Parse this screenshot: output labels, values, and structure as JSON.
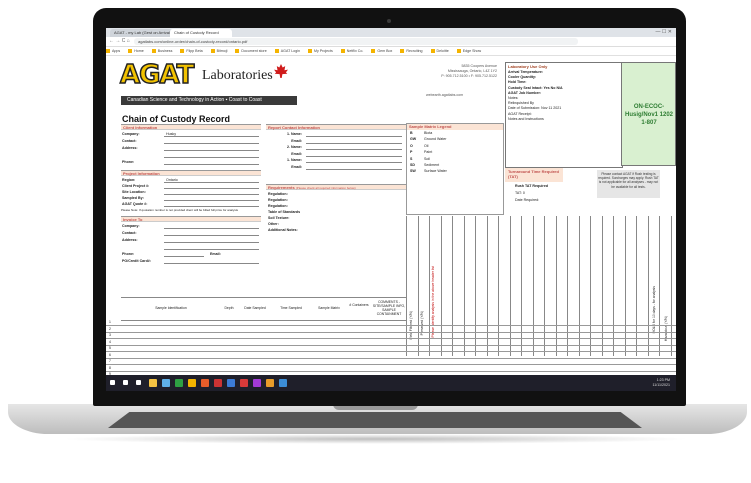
{
  "browser": {
    "tabs": [
      "AGAT - my Lab (Gest on Arrival)",
      "Chain of Custody Record"
    ],
    "nav": "← → C ⌂",
    "url": "agatlabs.com/online-order/chain-of-custody-record/ontario.pdf",
    "bookmarks": [
      "Apps",
      "Home",
      "Business",
      "Flipp Beta",
      "Bitmoji",
      "Document store",
      "AGAT Login",
      "My Projects",
      "Netflix Co.",
      "Gem Box",
      "Recruiting",
      "Deloitte",
      "Edge Show"
    ],
    "window_controls": "— ☐ ✕"
  },
  "logo": {
    "mark": "AGAT",
    "name": "Laboratories",
    "tagline": "Canadian Science and Technology in Action ▪ Coast to Coast"
  },
  "address": [
    "5835 Coopers Avenue",
    "Mississauga, Ontario, L4Z 1Y2",
    "P: 905.712.5100 • F: 905.712.5122"
  ],
  "website": "webearth.agatlabs.com",
  "lab_use": {
    "header": "Laboratory Use Only",
    "rows": [
      "Arrival Temperature:",
      "Cooler Quantity:",
      "Hold Time:",
      "Custody Seal Intact:    Yes    No    N/A",
      "AGAT Job Number:",
      "",
      "Notes:",
      "",
      "Relinquished By",
      "Date of Submission:   Nov   11   2021",
      "AGAT Receipt:",
      "Notes and Instructions"
    ]
  },
  "ref_code": [
    "ON-ECOC-",
    "Husig/Nov1 1202",
    "1-807"
  ],
  "title": "Chain of Custody Record",
  "client": {
    "header": "Client Information",
    "fields": [
      [
        "Company:",
        "Husky"
      ],
      [
        "Contact:",
        ""
      ],
      [
        "Address:",
        ""
      ],
      [
        "",
        ""
      ],
      [
        "Phone:",
        ""
      ]
    ]
  },
  "report": {
    "header": "Report Contact Information",
    "fields": [
      "1. Name:",
      "Email:",
      "2. Name:",
      "Email:",
      "1. Name:",
      "Email:"
    ]
  },
  "project": {
    "header": "Project Information",
    "fields": [
      [
        "Region:",
        "Ontario"
      ],
      [
        "Client Project #:",
        ""
      ],
      [
        "Site Location:",
        ""
      ],
      [
        "Sampled By:",
        ""
      ],
      [
        "AGAT Quote #:",
        ""
      ]
    ],
    "note": "Please Note: If quotation number is not provided client will be billed full price for analysis"
  },
  "requirements": {
    "header": "Requirements",
    "sub": "(Please check all required information below)",
    "fields": [
      "Regulation:",
      "Regulation:",
      "Regulation:",
      "Table of Standards",
      "Soil Texture:",
      "Other:",
      "Additional Notes:"
    ]
  },
  "invoice": {
    "header": "Invoice To",
    "fields": [
      "Company:",
      "Contact:",
      "Address:",
      "",
      "Phone:",
      "PO/Credit Card#:"
    ],
    "email": "Email:"
  },
  "matrix": {
    "header": "Sample Matrix Legend",
    "rows": [
      [
        "B",
        "Biota"
      ],
      [
        "GW",
        "Ground Water"
      ],
      [
        "O",
        "Oil"
      ],
      [
        "P",
        "Paint"
      ],
      [
        "S",
        "Soil"
      ],
      [
        "SD",
        "Sediment"
      ],
      [
        "SW",
        "Surface Water"
      ]
    ]
  },
  "tat": {
    "header": "Turnaround Time Required (TAT)",
    "rows": [
      "Rush TAT Required",
      "TAT:   0",
      "Date Required:"
    ],
    "note": "Please contact AGAT if Rush testing is required. Surcharges may apply. Rush TAT is not applicable for all analyses - may not be available for all tests."
  },
  "columns_vertical": [
    "Field Filtered (Y/N)",
    "Preserved (Y/N)",
    "Please Identify analysis in the above header list",
    "HOLD for 10 days - for analysis",
    "Hazardous (Y/N)"
  ],
  "sample_header": [
    "Sample Identification",
    "Depth",
    "Date Sampled",
    "Time Sampled",
    "Sample Matrix",
    "# Containers",
    "COMMENTS - SITE/SAMPLE INFO, SAMPLE CONTAINMENT"
  ],
  "row_numbers": [
    "1",
    "2",
    "3",
    "4",
    "5",
    "6",
    "7",
    "8",
    "9"
  ],
  "taskbar": {
    "time": "1:23 PM",
    "date": "11/11/2021"
  },
  "colors": {
    "section_bg": "#fbe4d5",
    "section_text": "#c0504d",
    "green_box": "#d9f0d0",
    "logo_yellow": "#f2c200",
    "taskbar": "#1f1f2a"
  }
}
